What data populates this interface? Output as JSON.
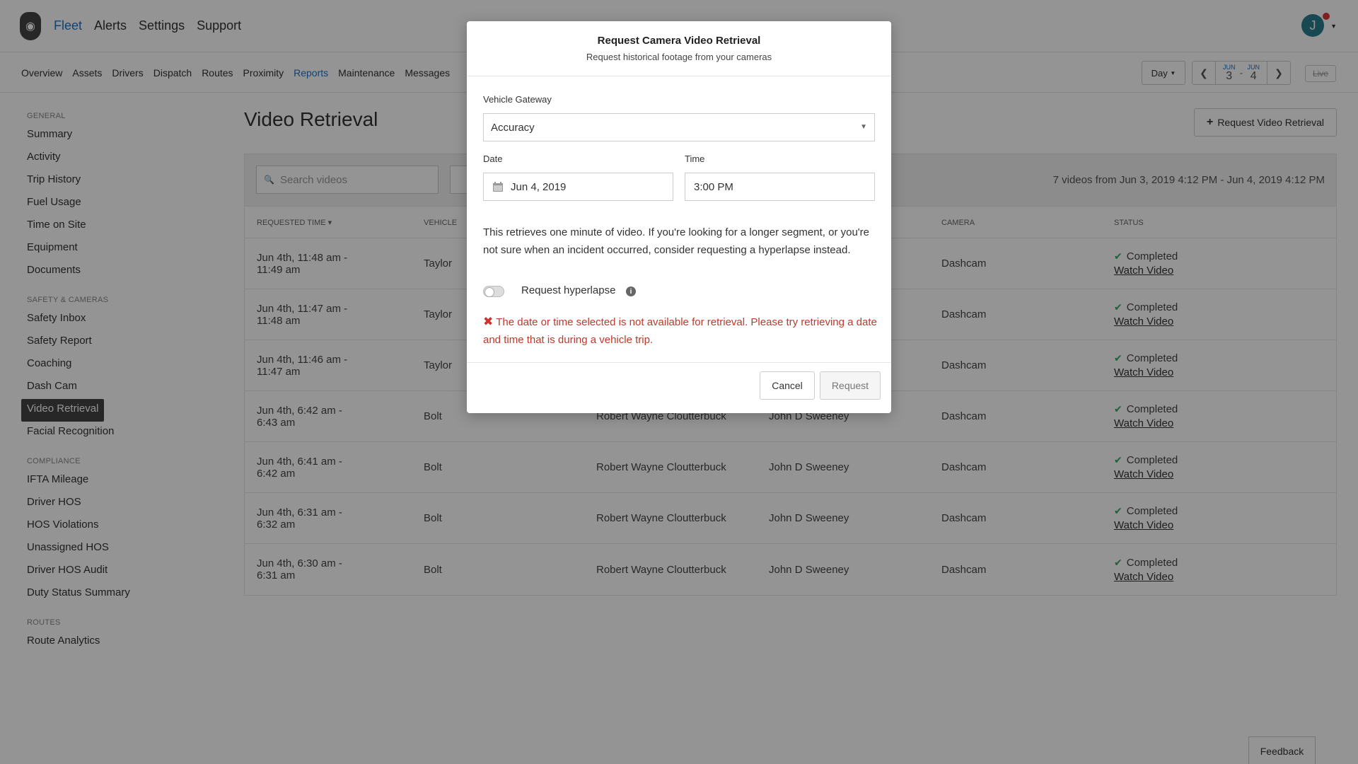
{
  "topnav": {
    "items": [
      "Fleet",
      "Alerts",
      "Settings",
      "Support"
    ],
    "active": "Fleet",
    "avatar_initial": "J"
  },
  "subnav": {
    "items": [
      "Overview",
      "Assets",
      "Drivers",
      "Dispatch",
      "Routes",
      "Proximity",
      "Reports",
      "Maintenance",
      "Messages"
    ],
    "active": "Reports",
    "period": "Day",
    "range_start_month": "JUN",
    "range_start_day": "3",
    "range_sep": "-",
    "range_end_month": "JUN",
    "range_end_day": "4",
    "live_label": "Live"
  },
  "sidebar": {
    "sections": [
      {
        "title": "GENERAL",
        "items": [
          "Summary",
          "Activity",
          "Trip History",
          "Fuel Usage",
          "Time on Site",
          "Equipment",
          "Documents"
        ]
      },
      {
        "title": "SAFETY & CAMERAS",
        "items": [
          "Safety Inbox",
          "Safety Report",
          "Coaching",
          "Dash Cam",
          "Video Retrieval",
          "Facial Recognition"
        ]
      },
      {
        "title": "COMPLIANCE",
        "items": [
          "IFTA Mileage",
          "Driver HOS",
          "HOS Violations",
          "Unassigned HOS",
          "Driver HOS Audit",
          "Duty Status Summary"
        ]
      },
      {
        "title": "ROUTES",
        "items": [
          "Route Analytics"
        ]
      }
    ],
    "active": "Video Retrieval"
  },
  "page": {
    "title": "Video Retrieval",
    "request_button": "Request Video Retrieval",
    "search_placeholder": "Search videos",
    "summary": "7 videos from Jun 3, 2019 4:12 PM - Jun 4, 2019 4:12 PM",
    "feedback": "Feedback"
  },
  "table": {
    "headers": [
      "REQUESTED TIME ▾",
      "VEHICLE",
      "",
      "",
      "CAMERA",
      "STATUS"
    ],
    "rows": [
      {
        "time": "Jun 4th, 11:48 am - 11:49 am",
        "vehicle": "Taylor",
        "col3": "",
        "col4": "",
        "camera": "Dashcam",
        "status": "Completed",
        "link": "Watch Video"
      },
      {
        "time": "Jun 4th, 11:47 am - 11:48 am",
        "vehicle": "Taylor",
        "col3": "",
        "col4": "",
        "camera": "Dashcam",
        "status": "Completed",
        "link": "Watch Video"
      },
      {
        "time": "Jun 4th, 11:46 am - 11:47 am",
        "vehicle": "Taylor",
        "col3": "",
        "col4": "",
        "camera": "Dashcam",
        "status": "Completed",
        "link": "Watch Video"
      },
      {
        "time": "Jun 4th, 6:42 am - 6:43 am",
        "vehicle": "Bolt",
        "col3": "Robert Wayne Cloutterbuck",
        "col4": "John D Sweeney",
        "camera": "Dashcam",
        "status": "Completed",
        "link": "Watch Video"
      },
      {
        "time": "Jun 4th, 6:41 am - 6:42 am",
        "vehicle": "Bolt",
        "col3": "Robert Wayne Cloutterbuck",
        "col4": "John D Sweeney",
        "camera": "Dashcam",
        "status": "Completed",
        "link": "Watch Video"
      },
      {
        "time": "Jun 4th, 6:31 am - 6:32 am",
        "vehicle": "Bolt",
        "col3": "Robert Wayne Cloutterbuck",
        "col4": "John D Sweeney",
        "camera": "Dashcam",
        "status": "Completed",
        "link": "Watch Video"
      },
      {
        "time": "Jun 4th, 6:30 am - 6:31 am",
        "vehicle": "Bolt",
        "col3": "Robert Wayne Cloutterbuck",
        "col4": "John D Sweeney",
        "camera": "Dashcam",
        "status": "Completed",
        "link": "Watch Video"
      }
    ]
  },
  "modal": {
    "title": "Request Camera Video Retrieval",
    "subtitle": "Request historical footage from your cameras",
    "gateway_label": "Vehicle Gateway",
    "gateway_value": "Accuracy",
    "date_label": "Date",
    "date_value": "Jun 4, 2019",
    "time_label": "Time",
    "time_value": "3:00 PM",
    "description": "This retrieves one minute of video. If you're looking for a longer segment, or you're not sure when an incident occurred, consider requesting a hyperlapse instead.",
    "hyperlapse_label": "Request hyperlapse",
    "hyperlapse_enabled": false,
    "error": "The date or time selected is not available for retrieval. Please try retrieving a date and time that is during a vehicle trip.",
    "cancel": "Cancel",
    "request": "Request"
  },
  "colors": {
    "accent": "#1d73c9",
    "error": "#c0392b",
    "success": "#3aa26a",
    "active_sidebar": "#444444"
  }
}
